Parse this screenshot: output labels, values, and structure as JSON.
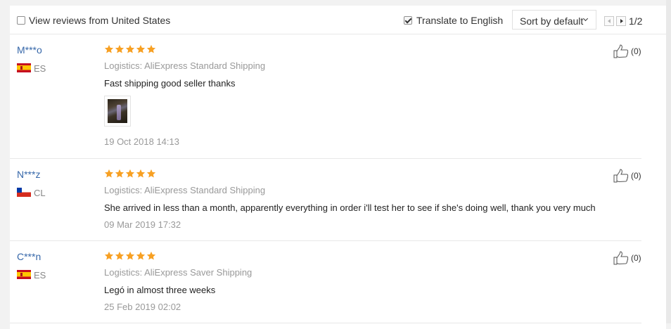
{
  "toolbar": {
    "view_us_label": "View reviews from United States",
    "view_us_checked": false,
    "translate_label": "Translate to English",
    "translate_checked": true,
    "sort_label": "Sort by default",
    "page_indicator": "1/2"
  },
  "colors": {
    "star": "#f7a023",
    "username": "#3667a9"
  },
  "reviews": [
    {
      "user": "M***o",
      "country": "ES",
      "flag": "spain-flag-icon",
      "rating": 5,
      "logistics": "Logistics: AliExpress Standard Shipping",
      "text": "Fast shipping good seller thanks",
      "has_photo": true,
      "date": "19 Oct 2018 14:13",
      "likes": "(0)"
    },
    {
      "user": "N***z",
      "country": "CL",
      "flag": "chile-flag-icon",
      "rating": 5,
      "logistics": "Logistics: AliExpress Standard Shipping",
      "text": "She arrived in less than a month, apparently everything in order i'll test her to see if she's doing well, thank you very much",
      "has_photo": false,
      "date": "09 Mar 2019 17:32",
      "likes": "(0)"
    },
    {
      "user": "C***n",
      "country": "ES",
      "flag": "spain-flag-icon",
      "rating": 5,
      "logistics": "Logistics: AliExpress Saver Shipping",
      "text": "Legó in almost three weeks",
      "has_photo": false,
      "date": "25 Feb 2019 02:02",
      "likes": "(0)"
    }
  ]
}
